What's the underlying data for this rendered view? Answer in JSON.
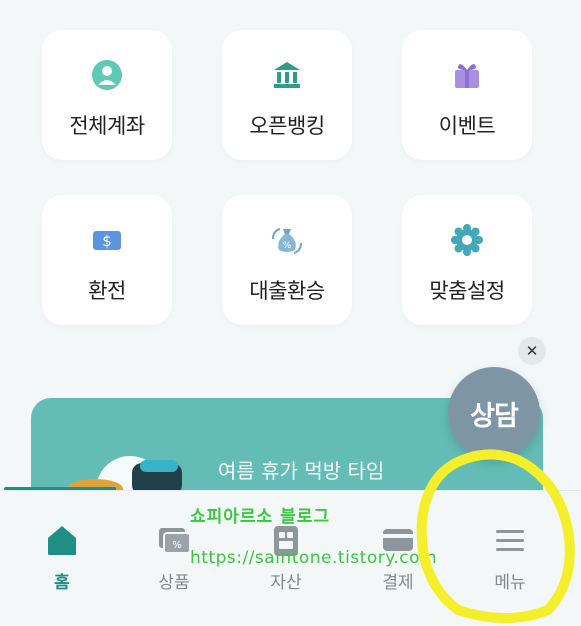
{
  "tiles": [
    {
      "label": "전체계좌",
      "icon": "person-icon"
    },
    {
      "label": "오픈뱅킹",
      "icon": "bank-icon"
    },
    {
      "label": "이벤트",
      "icon": "gift-icon"
    },
    {
      "label": "환전",
      "icon": "dollar-bill-icon"
    },
    {
      "label": "대출환승",
      "icon": "money-bag-icon"
    },
    {
      "label": "맞춤설정",
      "icon": "gear-icon"
    }
  ],
  "consult": {
    "label": "상담",
    "close": "✕"
  },
  "banner": {
    "text": "여름 휴가 먹방 타임"
  },
  "tabs": [
    {
      "label": "홈",
      "icon": "home-icon"
    },
    {
      "label": "상품",
      "icon": "product-icon"
    },
    {
      "label": "자산",
      "icon": "asset-icon"
    },
    {
      "label": "결제",
      "icon": "card-icon"
    },
    {
      "label": "메뉴",
      "icon": "menu-icon"
    }
  ],
  "watermark": {
    "line1": "쇼피아르소 블로그",
    "line2": "https://saintone.tistory.com"
  },
  "colors": {
    "accent": "#1f8f86",
    "banner": "#63bcb6",
    "consult": "#7e95a6",
    "highlight": "#f5ee2a"
  }
}
